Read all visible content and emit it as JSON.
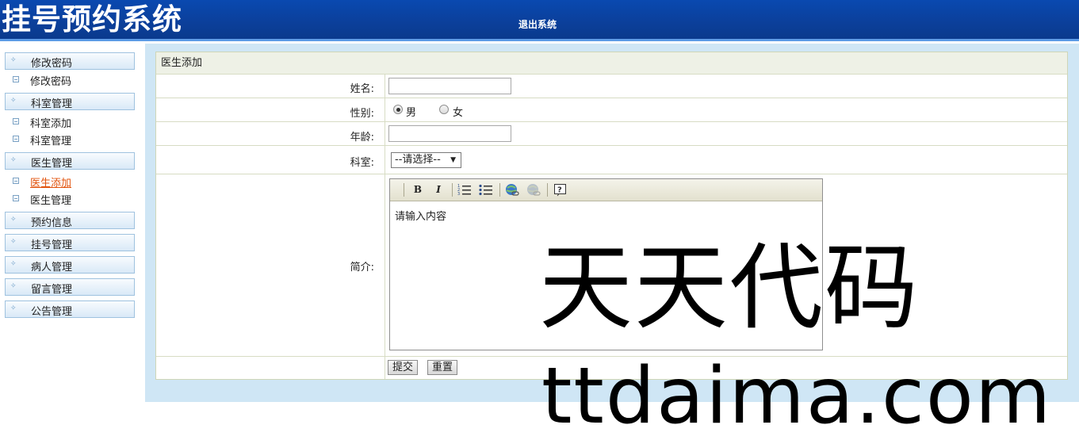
{
  "header": {
    "logo_text": "挂号预约系统",
    "logout_label": "退出系统"
  },
  "sidebar": {
    "groups": [
      {
        "label": "修改密码",
        "items": [
          "修改密码"
        ]
      },
      {
        "label": "科室管理",
        "items": [
          "科室添加",
          "科室管理"
        ]
      },
      {
        "label": "医生管理",
        "items": [
          "医生添加",
          "医生管理"
        ],
        "active_item": "医生添加"
      },
      {
        "label": "预约信息",
        "items": []
      },
      {
        "label": "挂号管理",
        "items": []
      },
      {
        "label": "病人管理",
        "items": []
      },
      {
        "label": "留言管理",
        "items": []
      },
      {
        "label": "公告管理",
        "items": []
      }
    ]
  },
  "form": {
    "title": "医生添加",
    "name_label": "姓名:",
    "name_value": "",
    "gender_label": "性别:",
    "gender_options": [
      "男",
      "女"
    ],
    "gender_selected": "男",
    "age_label": "年龄:",
    "age_value": "",
    "dept_label": "科室:",
    "dept_selected": "--请选择--",
    "intro_label": "简介:",
    "editor_toolbar": [
      "B",
      "I",
      "ordered-list",
      "unordered-list",
      "insert-link",
      "remove-link",
      "help"
    ],
    "editor_content": "请输入内容",
    "submit_label": "提交",
    "reset_label": "重置"
  },
  "watermark": {
    "line1": "天天代码",
    "line2": "ttdaima.com"
  },
  "colors": {
    "header_bg": "#0b3f9a",
    "active_link": "#e1530d",
    "main_bg": "#cfe6f5"
  }
}
